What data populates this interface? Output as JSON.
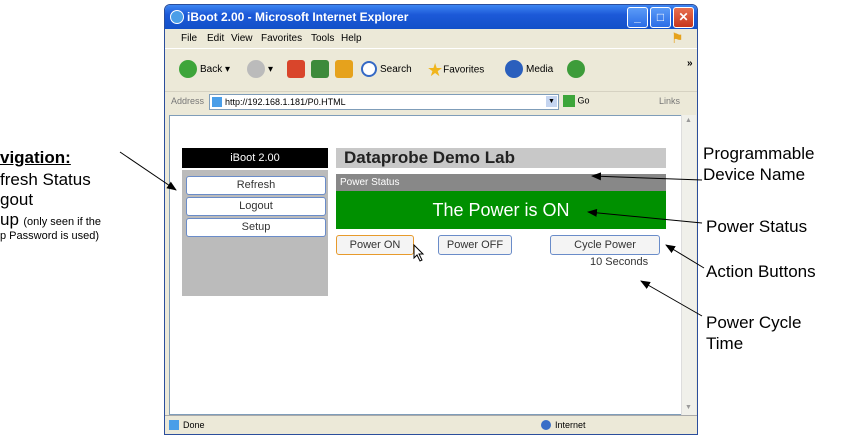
{
  "annotations": {
    "left": {
      "title": "vigation:",
      "line1": "fresh Status",
      "line2": "gout",
      "line3_big": "up",
      "line3_small": "(only seen if the",
      "line4": "p Password is used)"
    },
    "right": {
      "device_name_1": "Programmable",
      "device_name_2": "Device Name",
      "power_status": "Power Status",
      "action_buttons": "Action Buttons",
      "cycle_time_1": "Power Cycle",
      "cycle_time_2": "Time"
    }
  },
  "browser": {
    "title": "iBoot 2.00 - Microsoft Internet Explorer",
    "menu": [
      "File",
      "Edit",
      "View",
      "Favorites",
      "Tools",
      "Help"
    ],
    "toolbar": {
      "back": "Back",
      "search": "Search",
      "favorites": "Favorites",
      "media": "Media"
    },
    "address_label": "Address",
    "address_value": "http://192.168.1.181/P0.HTML",
    "go_label": "Go",
    "links_label": "Links",
    "status_left": "Done",
    "status_zone": "Internet"
  },
  "page": {
    "logo": "iBoot 2.00",
    "device_name": "Dataprobe Demo Lab",
    "nav": [
      "Refresh",
      "Logout",
      "Setup"
    ],
    "power_status_header": "Power Status",
    "power_status_text": "The Power is ON",
    "actions": [
      "Power ON",
      "Power OFF",
      "Cycle Power"
    ],
    "cycle_time": "10 Seconds"
  },
  "colors": {
    "power_on_bg": "#009000",
    "titlebar": "#1c59d8"
  }
}
